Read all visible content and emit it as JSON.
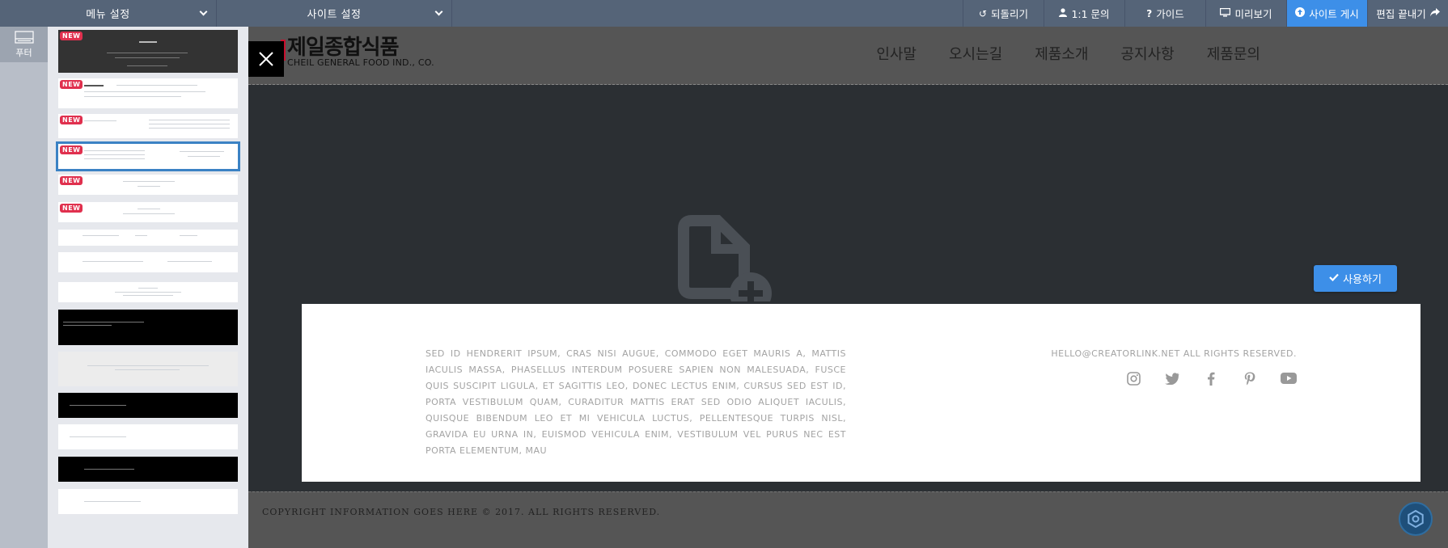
{
  "toolbar": {
    "menu_settings": "메뉴 설정",
    "site_settings": "사이트 설정",
    "buttons": [
      {
        "label": "되돌리기",
        "icon": "undo-icon"
      },
      {
        "label": "1:1 문의",
        "icon": "user-icon"
      },
      {
        "label": "가이드",
        "icon": "question-icon"
      },
      {
        "label": "미리보기",
        "icon": "monitor-icon"
      },
      {
        "label": "사이트 게시",
        "icon": "upload-circle-icon"
      },
      {
        "label": "편집 끝내기",
        "icon": "share-arrow-icon"
      }
    ],
    "active_color": "#3d8fe8"
  },
  "sidebar": {
    "footer_tab_label": "푸터",
    "new_badge": "NEW"
  },
  "site": {
    "logo_ko": "제일종합식품",
    "logo_en": "CHEIL GENERAL FOOD IND., CO.",
    "nav": [
      "인사말",
      "오시는길",
      "제품소개",
      "공지사항",
      "제품문의"
    ]
  },
  "use_button": "사용하기",
  "footer": {
    "body": "SED ID HENDRERIT IPSUM, CRAS NISI AUGUE, COMMODO EGET MAURIS A, MATTIS IACULIS MASSA, PHASELLUS INTERDUM POSUERE SAPIEN NON MALESUADA, FUSCE QUIS SUSCIPIT LIGULA, ET SAGITTIS LEO, DONEC LECTUS ENIM, CURSUS SED EST ID, PORTA VESTIBULUM QUAM, CURADITUR MATTIS ERAT SED ODIO ALIQUET IACULIS, QUISQUE BIBENDUM LEO ET MI VEHICULA LUCTUS, PELLENTESQUE TURPIS NISL, GRAVIDA EU URNA IN, EUISMOD VEHICULA ENIM, VESTIBULUM VEL PURUS NEC EST PORTA ELEMENTUM, MAU",
    "email": "HELLO@CREATORLINK.NET ALL RIGHTS RESERVED.",
    "socials": [
      "instagram-icon",
      "twitter-icon",
      "facebook-icon",
      "pinterest-icon",
      "youtube-icon"
    ]
  },
  "copyright": "COPYRIGHT INFORMATION GOES HERE © 2017. ALL RIGHTS RESERVED."
}
